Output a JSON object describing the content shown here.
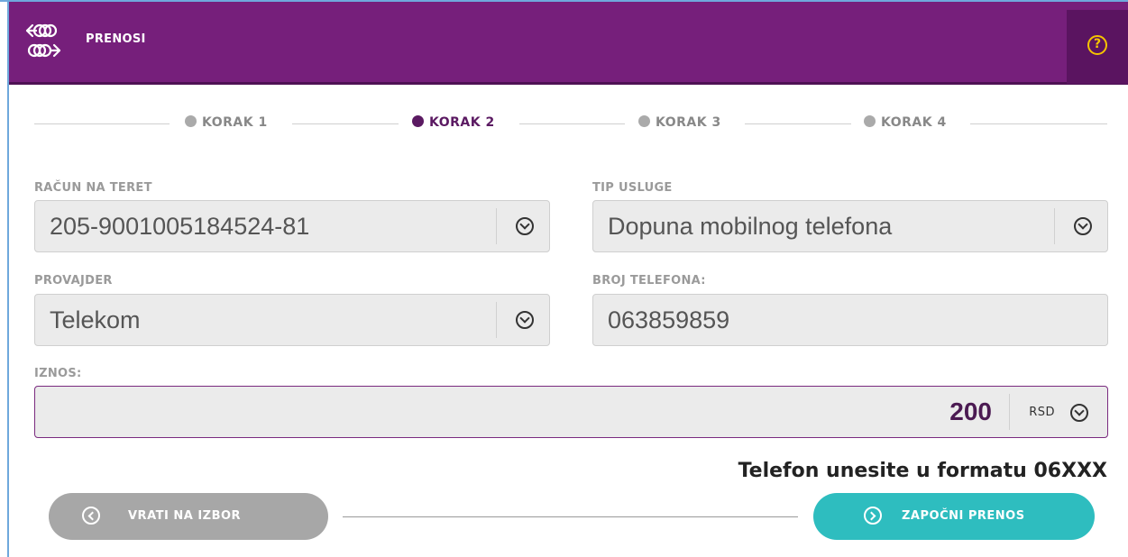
{
  "header": {
    "title": "PRENOSI",
    "help_icon": "?"
  },
  "steps": [
    {
      "label": "KORAK 1",
      "active": false
    },
    {
      "label": "KORAK 2",
      "active": true
    },
    {
      "label": "KORAK 3",
      "active": false
    },
    {
      "label": "KORAK 4",
      "active": false
    }
  ],
  "form": {
    "account_label": "RAČUN NA TERET",
    "account_value": "205-9001005184524-81",
    "service_label": "TIP USLUGE",
    "service_value": "Dopuna mobilnog telefona",
    "provider_label": "PROVAJDER",
    "provider_value": "Telekom",
    "phone_label": "BROJ TELEFONA:",
    "phone_value": "063859859",
    "amount_label": "IZNOS:",
    "amount_value": "200",
    "currency": "RSD"
  },
  "hint": "Telefon unesite u formatu 06XXX",
  "buttons": {
    "back": "VRATI NA IZBOR",
    "start": "ZAPOČNI PRENOS"
  },
  "colors": {
    "header_bg": "#761f7b",
    "active_step": "#5b1a62",
    "start_button": "#2ebdbf",
    "back_button": "#a7a7a7",
    "help_icon": "#f5c400"
  }
}
